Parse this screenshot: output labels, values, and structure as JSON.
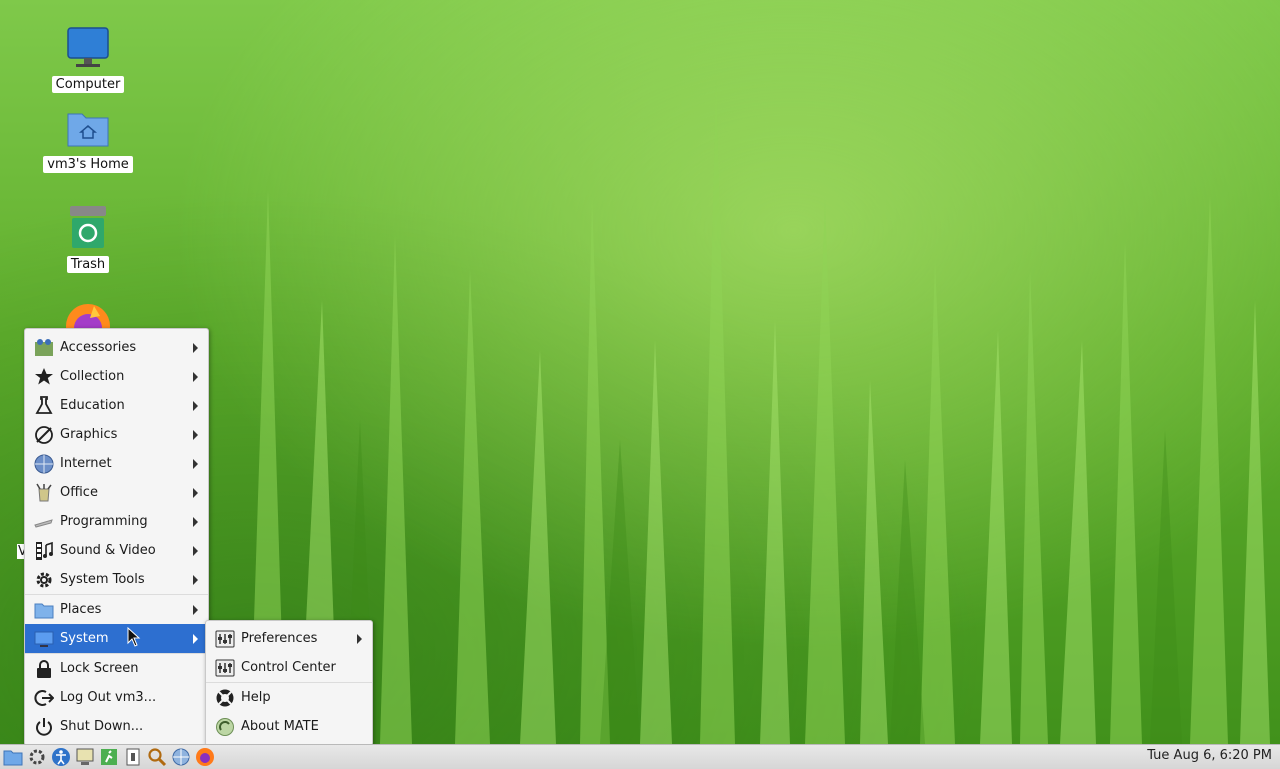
{
  "desktop": {
    "icons": [
      {
        "label": "Computer",
        "icon": "monitor-icon"
      },
      {
        "label": "vm3's Home",
        "icon": "home-folder-icon"
      },
      {
        "label": "Trash",
        "icon": "trash-icon"
      }
    ],
    "stray_label": "V"
  },
  "menu": {
    "items": [
      {
        "label": "Accessories",
        "icon": "accessories-icon",
        "submenu": true
      },
      {
        "label": "Collection",
        "icon": "star-icon",
        "submenu": true
      },
      {
        "label": "Education",
        "icon": "flask-icon",
        "submenu": true
      },
      {
        "label": "Graphics",
        "icon": "graphics-icon",
        "submenu": true
      },
      {
        "label": "Internet",
        "icon": "globe-icon",
        "submenu": true
      },
      {
        "label": "Office",
        "icon": "office-icon",
        "submenu": true
      },
      {
        "label": "Programming",
        "icon": "programming-icon",
        "submenu": true
      },
      {
        "label": "Sound & Video",
        "icon": "film-music-icon",
        "submenu": true
      },
      {
        "label": "System Tools",
        "icon": "gear-icon",
        "submenu": true
      },
      {
        "label": "Places",
        "icon": "folder-icon",
        "submenu": true
      },
      {
        "label": "System",
        "icon": "monitor-icon",
        "submenu": true,
        "active": true
      },
      {
        "label": "Lock Screen",
        "icon": "lock-icon"
      },
      {
        "label": "Log Out vm3...",
        "icon": "logout-icon"
      },
      {
        "label": "Shut Down...",
        "icon": "power-icon"
      }
    ]
  },
  "submenu": {
    "items": [
      {
        "label": "Preferences",
        "icon": "preferences-icon",
        "submenu": true
      },
      {
        "label": "Control Center",
        "icon": "control-center-icon"
      },
      {
        "label": "Help",
        "icon": "help-lifebuoy-icon"
      },
      {
        "label": "About MATE",
        "icon": "mate-icon"
      }
    ]
  },
  "panel": {
    "launchers": [
      "menu-icon",
      "settings-icon",
      "accessibility-icon",
      "terminal-icon",
      "run-icon",
      "notes-icon",
      "search-icon",
      "network-icon",
      "firefox-icon"
    ],
    "clock": "Tue Aug  6,  6:20 PM"
  },
  "colors": {
    "accent": "#2d6fd0",
    "menu_bg": "#f5f5f5",
    "panel_bg": "#dcdcdc"
  }
}
